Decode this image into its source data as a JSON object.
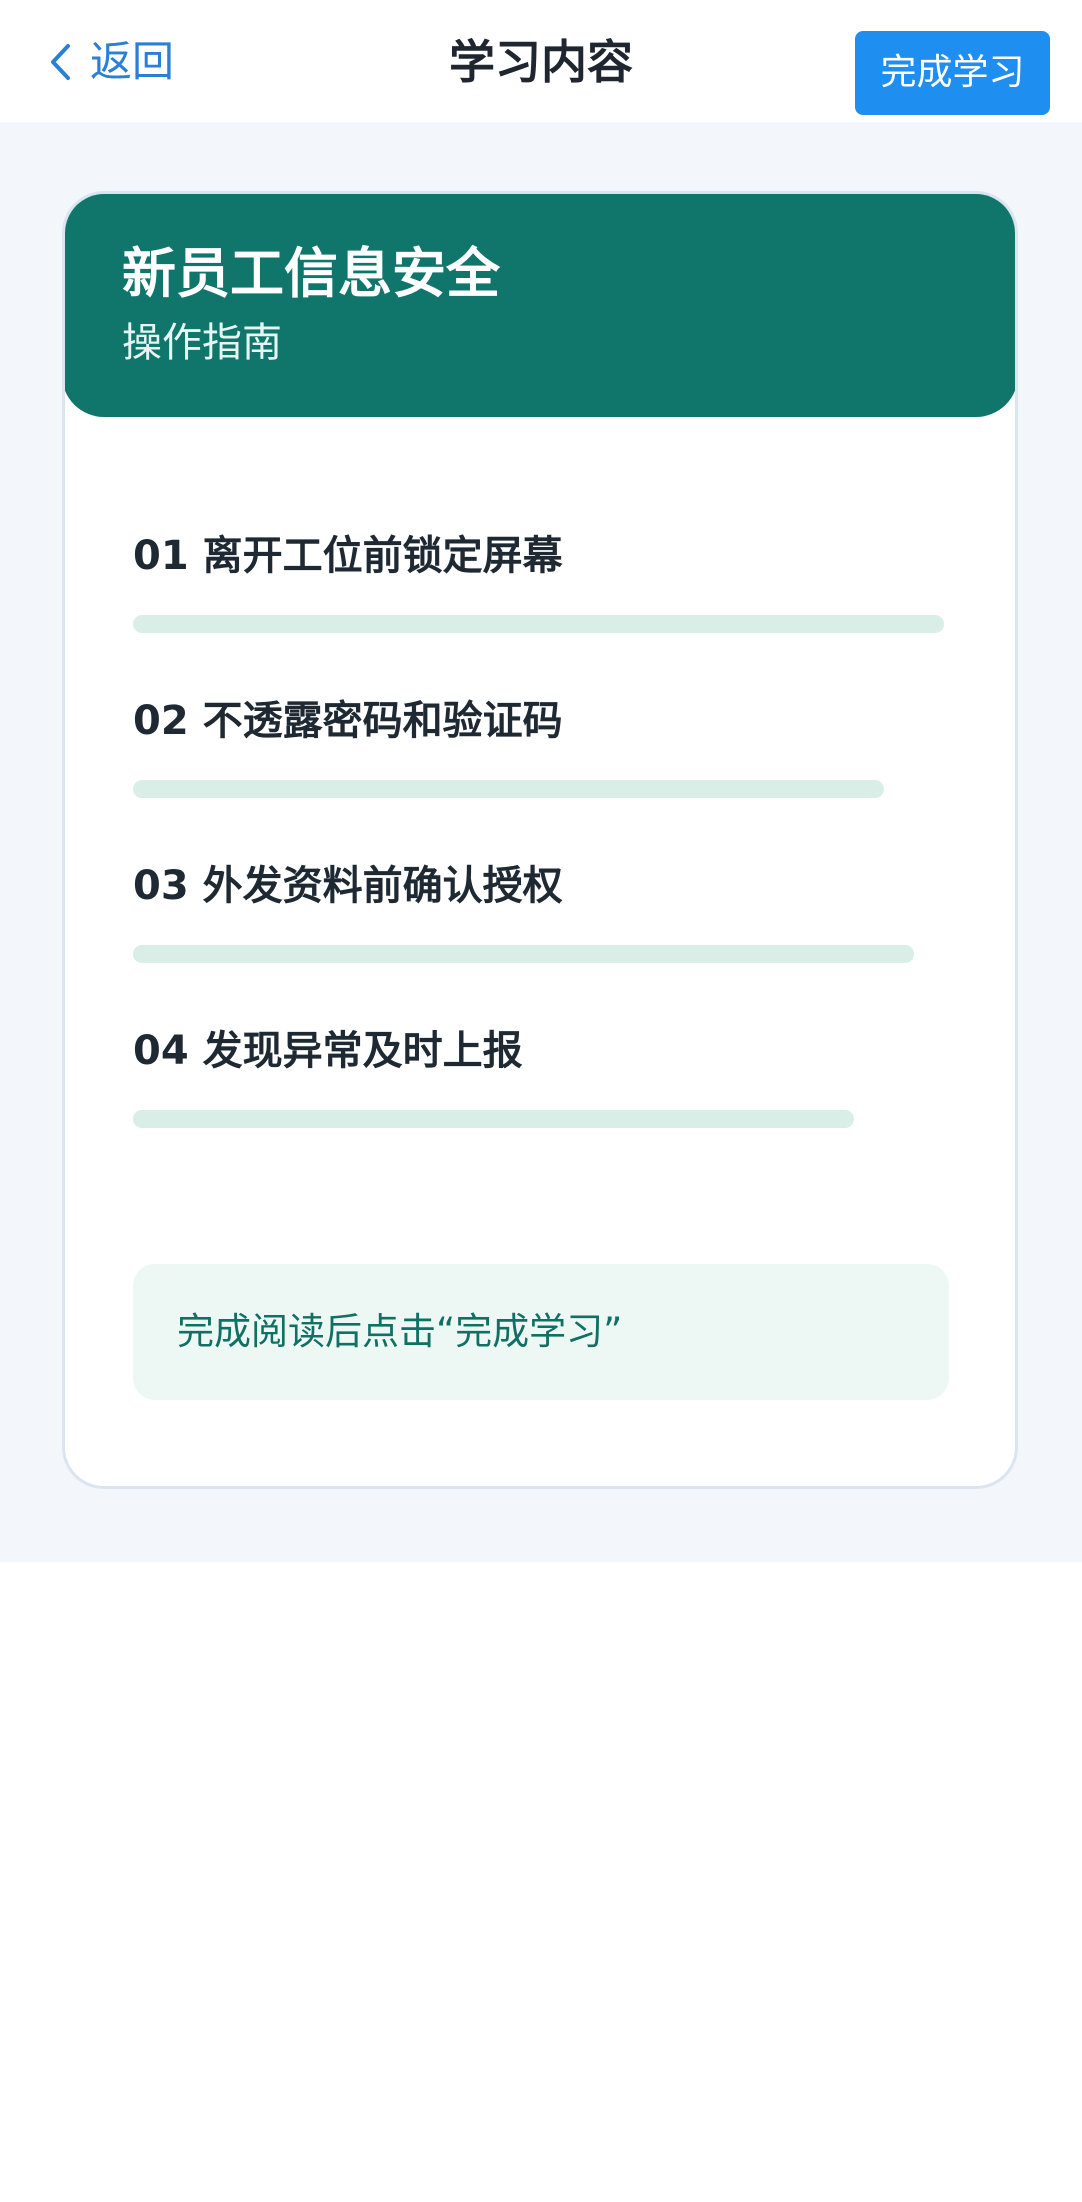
{
  "nav": {
    "back_label": "返回",
    "title": "学习内容",
    "finish_label": "完成学习"
  },
  "card": {
    "title": "新员工信息安全",
    "subtitle": "操作指南",
    "items": [
      {
        "label": "01 离开工位前锁定屏幕"
      },
      {
        "label": "02 不透露密码和验证码"
      },
      {
        "label": "03 外发资料前确认授权"
      },
      {
        "label": "04 发现异常及时上报"
      }
    ],
    "notice": "完成阅读后点击“完成学习”"
  },
  "colors": {
    "accent_blue": "#1f8ef1",
    "link_blue": "#2b7fd6",
    "header_teal": "#10766c",
    "bar_mint": "#d9eee7",
    "page_bg": "#f3f7fc"
  },
  "icons": {
    "back": "chevron-left-icon"
  }
}
